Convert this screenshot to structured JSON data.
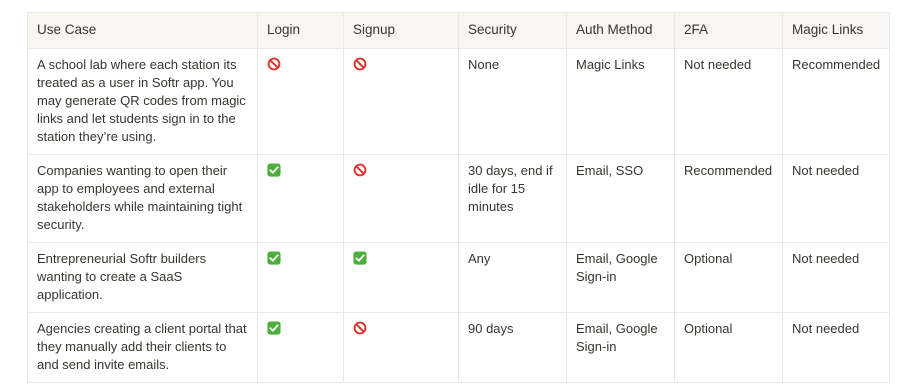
{
  "table": {
    "headers": [
      "Use Case",
      "Login",
      "Signup",
      "Security",
      "Auth Method",
      "2FA",
      "Magic Links"
    ],
    "rows": [
      {
        "use_case": "A school lab where each station its treated as a user in Softr app. You may generate QR codes from magic links and let students sign in to the station they’re using.",
        "login": "prohibited-icon",
        "signup": "prohibited-icon",
        "security": "None",
        "auth_method": "Magic Links",
        "twofa": "Not needed",
        "magic_links": "Recommended"
      },
      {
        "use_case": "Companies wanting to open their app to employees and external stakeholders while maintaining tight security.",
        "login": "check-mark-icon",
        "signup": "prohibited-icon",
        "security": "30 days, end if idle for 15 minutes",
        "auth_method": "Email, SSO",
        "twofa": "Recommended",
        "magic_links": "Not needed"
      },
      {
        "use_case": "Entrepreneurial Softr builders wanting to create a SaaS application.",
        "login": "check-mark-icon",
        "signup": "check-mark-icon",
        "security": "Any",
        "auth_method": "Email, Google Sign-in",
        "twofa": "Optional",
        "magic_links": "Not needed"
      },
      {
        "use_case": "Agencies creating a client portal that they manually add their clients to and send invite emails.",
        "login": "check-mark-icon",
        "signup": "prohibited-icon",
        "security": "90 days",
        "auth_method": "Email, Google Sign-in",
        "twofa": "Optional",
        "magic_links": "Not needed"
      }
    ]
  },
  "colors": {
    "border": "#e9e9e7",
    "header_bg": "#f7f6f3",
    "text": "#37352f",
    "check_green": "#4caf3a",
    "prohibited_red": "#e0342b"
  }
}
